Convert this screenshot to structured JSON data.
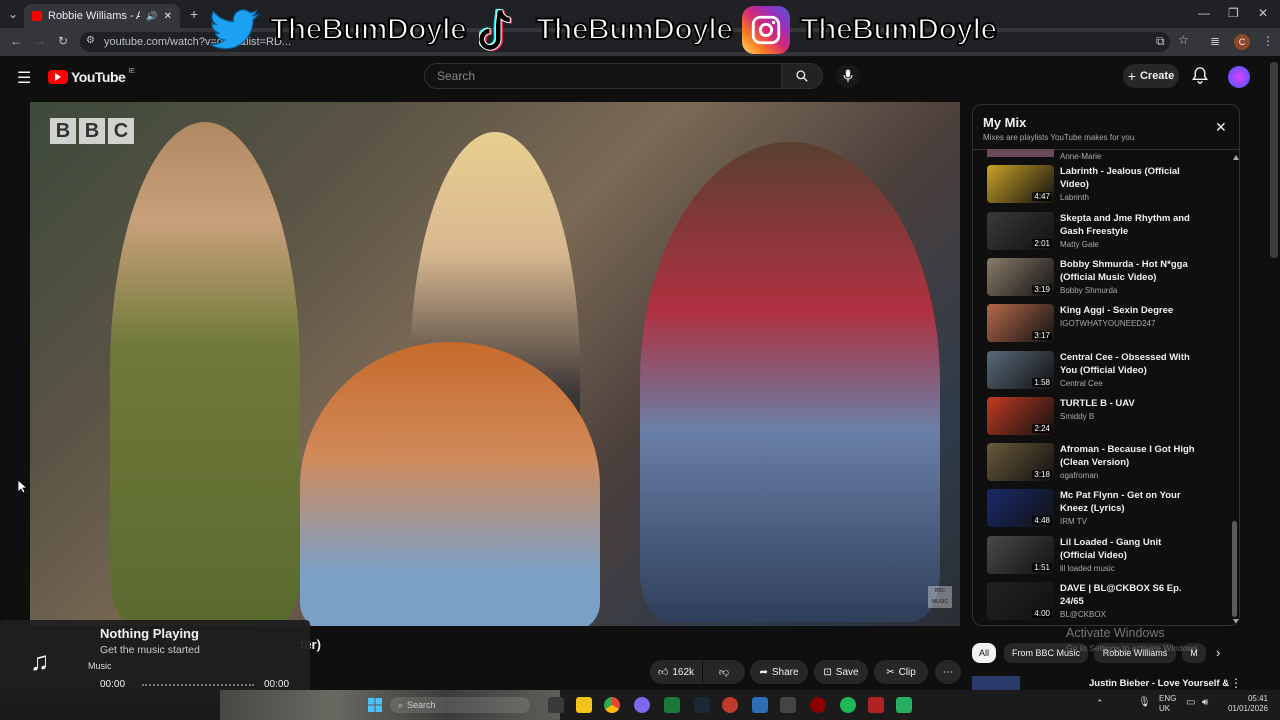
{
  "browser": {
    "tab_title": "Robbie Williams - Angels (L",
    "url": "youtube.com/watch?v=gZ...&list=RD..."
  },
  "overlay": {
    "handles": [
      {
        "icon": "twitter-icon",
        "name": "TheBumDoyle",
        "color": "#1da1f2"
      },
      {
        "icon": "tiktok-icon",
        "name": "TheBumDoyle",
        "color": "#000000"
      },
      {
        "icon": "instagram-icon",
        "name": "TheBumDoyle",
        "color": "#d62976"
      }
    ]
  },
  "youtube": {
    "logo_text": "YouTube",
    "region": "IE",
    "search_placeholder": "Search",
    "create_label": "Create"
  },
  "video": {
    "channel_bug": "BBC",
    "corner_bug": "BBC MUSIC",
    "title_fragment": "ter)",
    "channel_fragment": "Music",
    "likes": "162k",
    "share_label": "Share",
    "save_label": "Save",
    "clip_label": "Clip"
  },
  "mix": {
    "title": "My Mix",
    "subtitle": "Mixes are playlists YouTube makes for you",
    "partial_channel": "Anne-Marie",
    "items": [
      {
        "title": "Labrinth - Jealous (Official Video)",
        "channel": "Labrinth",
        "duration": "4:47",
        "color": "#c9a227"
      },
      {
        "title": "Skepta and Jme Rhythm and Gash Freestyle",
        "channel": "Matty Gale",
        "duration": "2:01",
        "color": "#3a3a3a"
      },
      {
        "title": "Bobby Shmurda - Hot N*gga (Official Music Video)",
        "channel": "Bobby Shmurda",
        "duration": "3:19",
        "color": "#8a7d6a"
      },
      {
        "title": "King Aggi - Sexin Degree",
        "channel": "IGOTWHATYOUNEED247",
        "duration": "3:17",
        "color": "#b56a4a"
      },
      {
        "title": "Central Cee - Obsessed With You (Official Video)",
        "channel": "Central Cee",
        "duration": "1:58",
        "color": "#5a6a7a"
      },
      {
        "title": "TURTLE B - UAV",
        "channel": "Smiddy B",
        "duration": "2:24",
        "color": "#c23b22"
      },
      {
        "title": "Afroman - Because I Got High (Clean Version)",
        "channel": "ogafroman",
        "duration": "3:18",
        "color": "#6a5a3a"
      },
      {
        "title": "Mc Pat Flynn - Get on Your Kneez (Lyrics)",
        "channel": "IRM TV",
        "duration": "4:48",
        "color": "#1a2a6a"
      },
      {
        "title": "Lil Loaded - Gang Unit (Official Video)",
        "channel": "lil loaded music",
        "duration": "1:51",
        "color": "#4a4a4a"
      },
      {
        "title": "DAVE | BL@CKBOX S6 Ep. 24/65",
        "channel": "BL@CKBOX",
        "duration": "4:00",
        "color": "#222222"
      }
    ]
  },
  "chips": {
    "all": "All",
    "bbc": "From BBC Music",
    "robbie": "Robbie Williams",
    "more": "M"
  },
  "next_up": "Justin Bieber - Love Yourself &",
  "activate": {
    "title": "Activate Windows",
    "subtitle": "Go to Settings to activate Windows."
  },
  "music_widget": {
    "title": "Nothing Playing",
    "subtitle": "Get the music started",
    "time_start": "00:00",
    "time_end": "00:00"
  },
  "taskbar": {
    "search": "Search",
    "lang": "ENG",
    "region": "UK",
    "time": "05:41",
    "date": "01/01/2026"
  }
}
